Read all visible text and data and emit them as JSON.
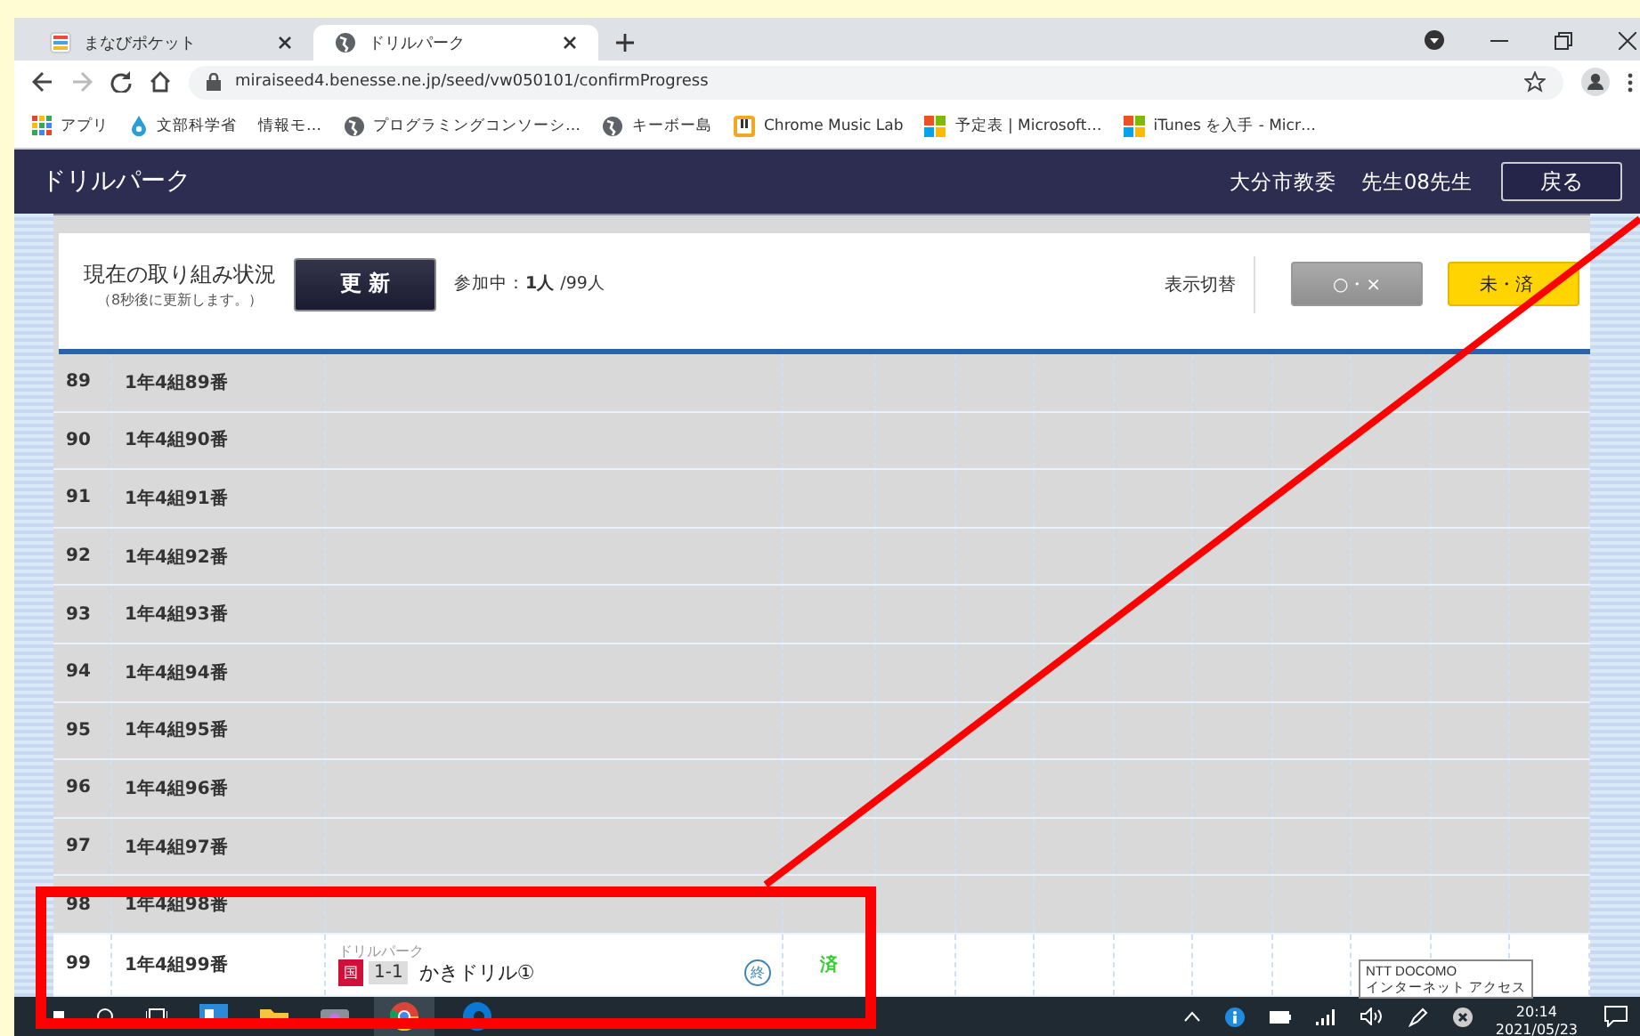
{
  "tabs": [
    {
      "label": "まなびポケット",
      "kind": "pocket",
      "selected": false
    },
    {
      "label": "ドリルパーク",
      "kind": "globe",
      "selected": true
    }
  ],
  "address": "miraiseed4.benesse.ne.jp/seed/vw050101/confirmProgress",
  "bookmarks": [
    {
      "label": "アプリ",
      "kind": "apps"
    },
    {
      "label": "文部科学省",
      "kind": "drop"
    },
    {
      "label": "情報モ…",
      "kind": "none"
    },
    {
      "label": "プログラミングコンソーシ…",
      "kind": "globe"
    },
    {
      "label": "キーボー島",
      "kind": "globe"
    },
    {
      "label": "Chrome Music Lab",
      "kind": "music"
    },
    {
      "label": "予定表 | Microsoft…",
      "kind": "msft"
    },
    {
      "label": "iTunes を入手 - Micr…",
      "kind": "msft"
    }
  ],
  "app": {
    "title": "ドリルパーク",
    "org": "大分市教委",
    "user": "先生08先生",
    "back_button": "戻る"
  },
  "status_panel": {
    "title": "現在の取り組み状況",
    "note": "（8秒後に更新します。）",
    "refresh_button": "更 新",
    "participants": "参加中：**1人** /99人",
    "toggle_label": "表示切替",
    "toggles": [
      {
        "label": "○・×",
        "selected": false
      },
      {
        "label": "未・済",
        "selected": true
      }
    ]
  },
  "rows": [
    {
      "number": "89",
      "name": "1年4組89番",
      "highlighted": false
    },
    {
      "number": "90",
      "name": "1年4組90番",
      "highlighted": false
    },
    {
      "number": "91",
      "name": "1年4組91番",
      "highlighted": false
    },
    {
      "number": "92",
      "name": "1年4組92番",
      "highlighted": false
    },
    {
      "number": "93",
      "name": "1年4組93番",
      "highlighted": false
    },
    {
      "number": "94",
      "name": "1年4組94番",
      "highlighted": false
    },
    {
      "number": "95",
      "name": "1年4組95番",
      "highlighted": false
    },
    {
      "number": "96",
      "name": "1年4組96番",
      "highlighted": false
    },
    {
      "number": "97",
      "name": "1年4組97番",
      "highlighted": false
    },
    {
      "number": "98",
      "name": "1年4組98番",
      "highlighted": false
    },
    {
      "number": "99",
      "name": "1年4組99番",
      "highlighted": true,
      "drill": {
        "source": "ドリルパーク",
        "subject": "国",
        "color": "#d0103a",
        "unit": "1-1",
        "title": "かきドリル①",
        "mark": "終"
      },
      "status": "済"
    }
  ],
  "tooltip": [
    "NTT DOCOMO",
    "インターネット アクセス"
  ],
  "taskbar": {
    "time": "20:14",
    "date": "2021/05/23"
  }
}
